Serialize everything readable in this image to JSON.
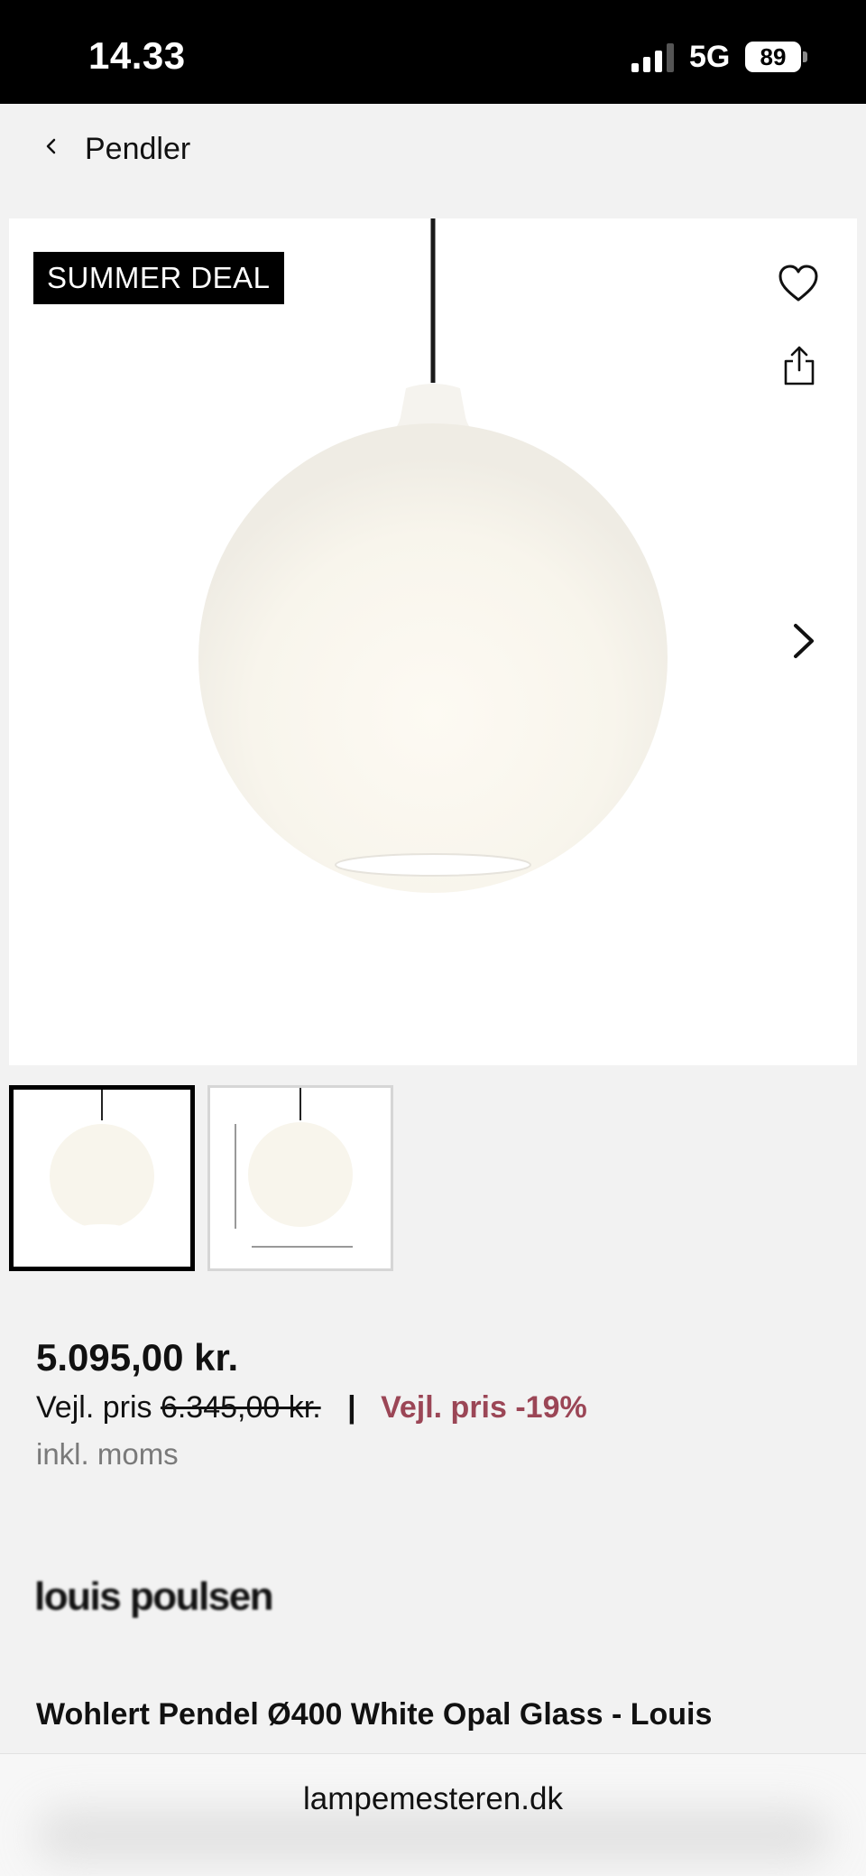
{
  "status_bar": {
    "time": "14.33",
    "network": "5G",
    "battery": "89",
    "icons": [
      "signal-icon",
      "battery-icon"
    ]
  },
  "header": {
    "back_label": "Pendler",
    "back_icon": "chevron-left-icon"
  },
  "gallery": {
    "badge": "SUMMER DEAL",
    "icons": [
      "heart-icon",
      "share-icon",
      "chevron-right-icon"
    ]
  },
  "price": {
    "current": "5.095,00 kr.",
    "rrp_label": "Vejl. pris",
    "rrp_value": "6.345,00 kr.",
    "separator": "|",
    "discount": "Vejl. pris -19%",
    "vat_note": "inkl. moms",
    "discount_color": "#9b4656"
  },
  "brand": "louis poulsen",
  "product": {
    "title": "Wohlert Pendel Ø400 White Opal Glass - Louis"
  },
  "browser": {
    "url": "lampemesteren.dk"
  }
}
